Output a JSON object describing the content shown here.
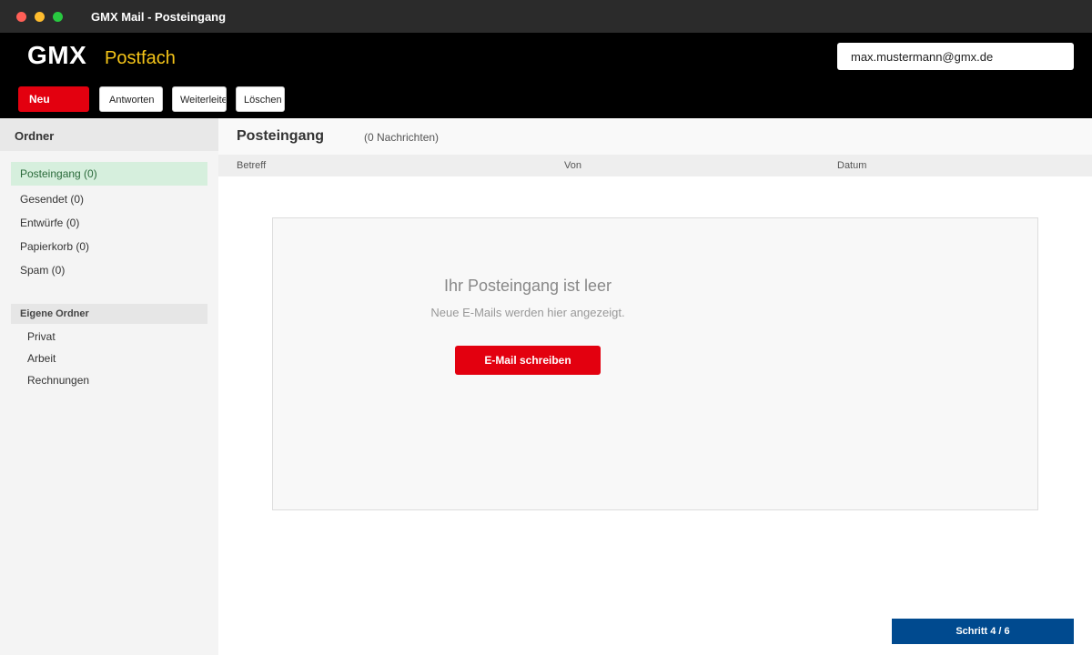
{
  "window": {
    "title": "GMX Mail - Posteingang",
    "controls": {
      "close_color": "#ff5f57",
      "minimize_color": "#febc2e",
      "maximize_color": "#28c840"
    }
  },
  "header": {
    "logo": "GMX",
    "section": "Postfach",
    "section_color": "#f5c518",
    "account_email": "max.mustermann@gmx.de"
  },
  "toolbar": {
    "new_label": "Neu",
    "reply_label": "Antworten",
    "forward_label": "Weiterleiten",
    "delete_label": "Löschen"
  },
  "sidebar": {
    "heading": "Ordner",
    "folders": [
      {
        "label": "Posteingang (0)",
        "active": true
      },
      {
        "label": "Gesendet (0)"
      },
      {
        "label": "Entwürfe (0)"
      },
      {
        "label": "Papierkorb (0)"
      },
      {
        "label": "Spam (0)"
      }
    ],
    "own_folders_heading": "Eigene Ordner",
    "own_folders": [
      "Privat",
      "Arbeit",
      "Rechnungen"
    ]
  },
  "main": {
    "title": "Posteingang",
    "count": "(0 Nachrichten)",
    "columns": [
      "Betreff",
      "Von",
      "Datum"
    ],
    "empty_title": "Ihr Posteingang ist leer",
    "empty_subtitle": "Neue E-Mails werden hier angezeigt.",
    "compose_label": "E-Mail schreiben"
  },
  "step_badge": "Schritt 4 / 6",
  "colors": {
    "brand_red": "#e3000f",
    "active_folder_bg": "#d6efdd",
    "step_badge_bg": "#004a8f"
  }
}
